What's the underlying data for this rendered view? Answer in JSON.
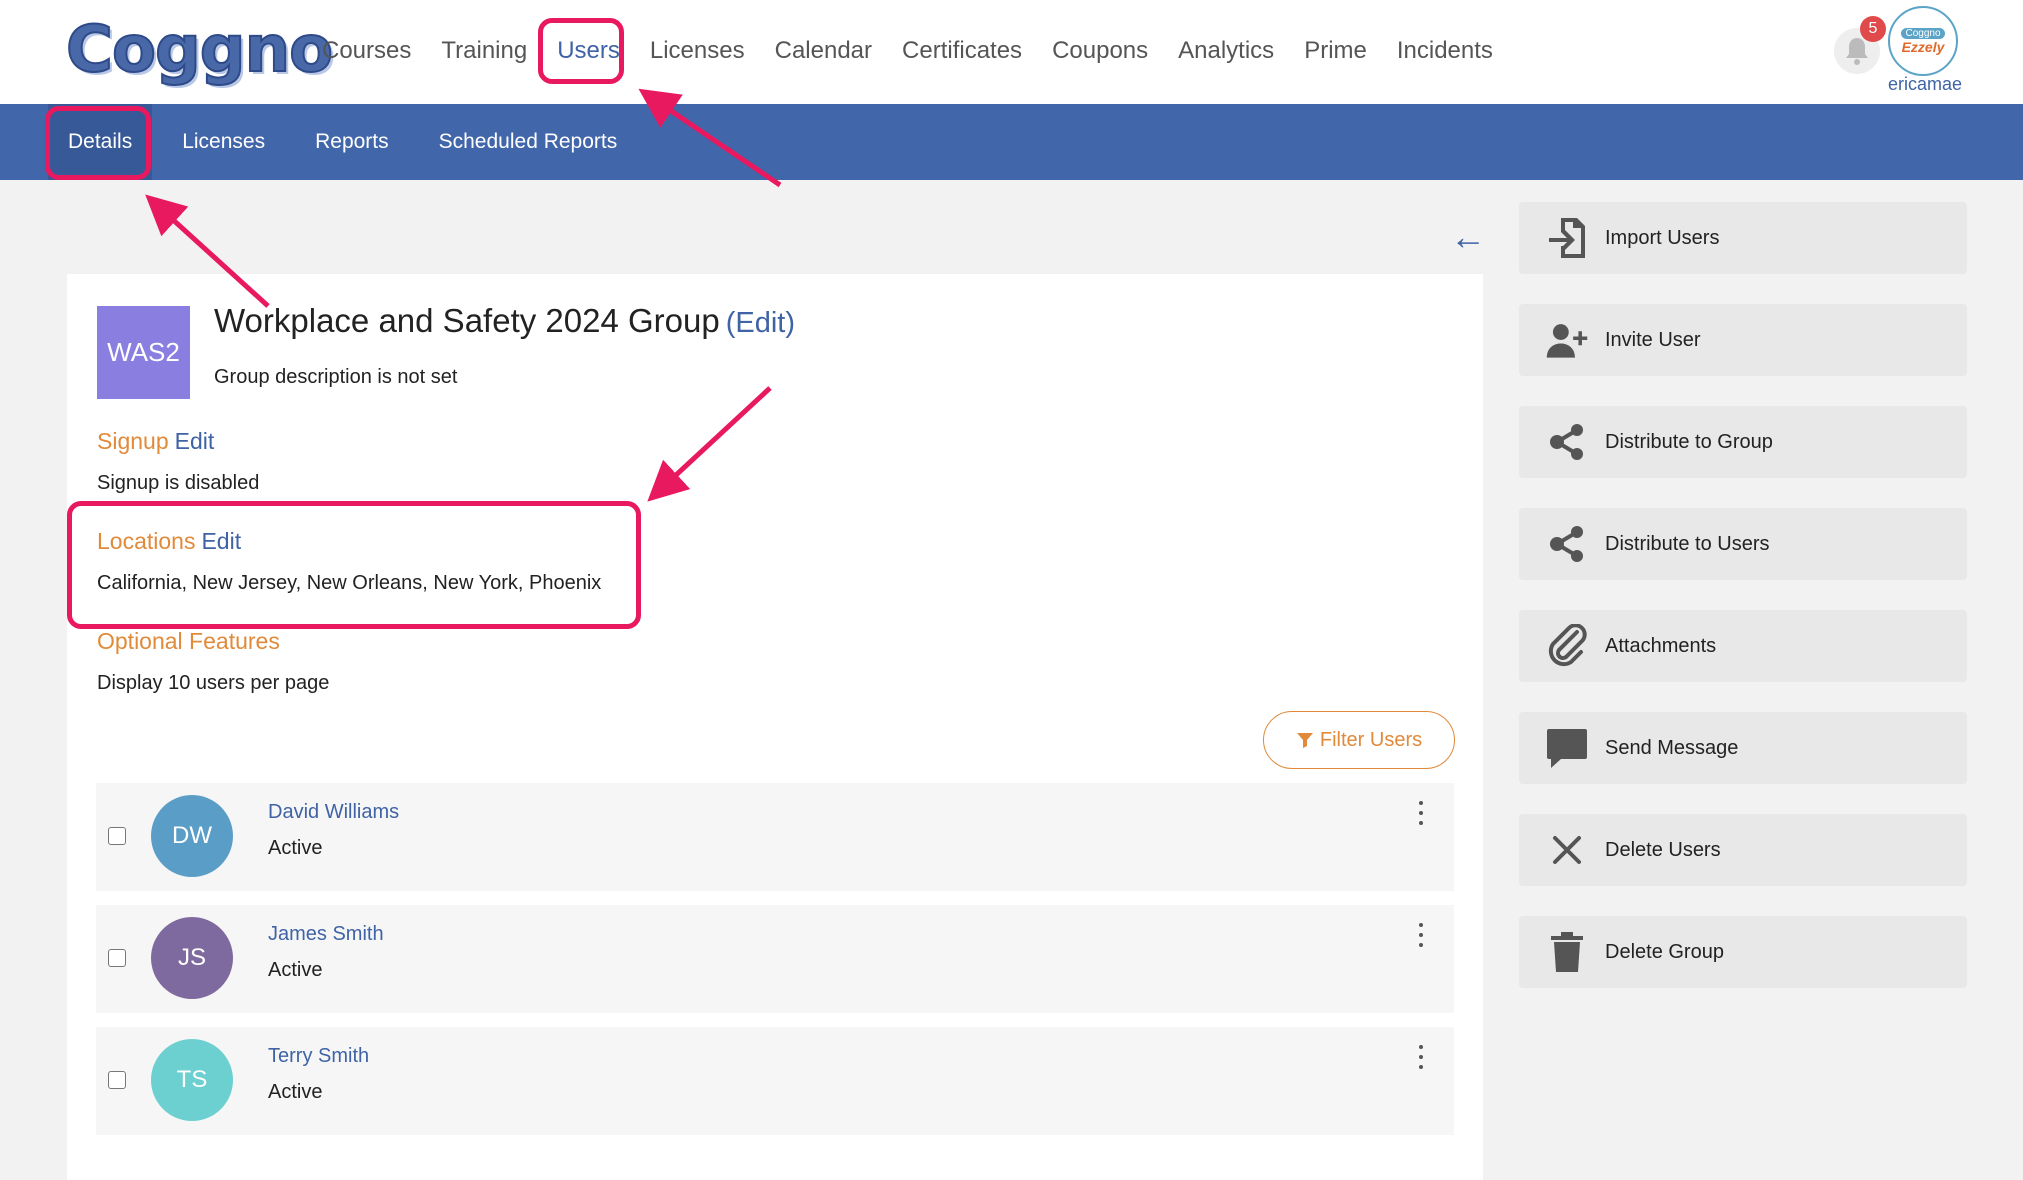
{
  "header": {
    "logo_text": "Coggno",
    "nav": [
      "Courses",
      "Training",
      "Users",
      "Licenses",
      "Calendar",
      "Certificates",
      "Coupons",
      "Analytics",
      "Prime",
      "Incidents"
    ],
    "active_nav": "Users",
    "notification_count": "5",
    "avatar_brand_top": "Coggno",
    "avatar_brand": "Ezzely",
    "username": "ericamae"
  },
  "subnav": {
    "items": [
      "Details",
      "Licenses",
      "Reports",
      "Scheduled Reports"
    ],
    "active": "Details"
  },
  "group": {
    "tile_text": "WAS2",
    "title": "Workplace and Safety 2024 Group",
    "edit_label": "(Edit)",
    "description": "Group description is not set"
  },
  "sections": {
    "signup": {
      "heading": "Signup",
      "edit": "Edit",
      "text": "Signup is disabled"
    },
    "locations": {
      "heading": "Locations",
      "edit": "Edit",
      "text": "California, New Jersey, New Orleans, New York, Phoenix"
    },
    "optional": {
      "heading": "Optional Features",
      "text": "Display 10 users per page"
    }
  },
  "filter_label": "Filter Users",
  "users": [
    {
      "initials": "DW",
      "name": "David Williams",
      "status": "Active",
      "color": "#5a9ec8"
    },
    {
      "initials": "JS",
      "name": "James Smith",
      "status": "Active",
      "color": "#7e6a9e"
    },
    {
      "initials": "TS",
      "name": "Terry Smith",
      "status": "Active",
      "color": "#6ccfd0"
    }
  ],
  "sidebar": [
    {
      "label": "Import Users",
      "icon": "import-icon"
    },
    {
      "label": "Invite User",
      "icon": "add-user-icon"
    },
    {
      "label": "Distribute to Group",
      "icon": "share-icon"
    },
    {
      "label": "Distribute to Users",
      "icon": "share-icon"
    },
    {
      "label": "Attachments",
      "icon": "paperclip-icon"
    },
    {
      "label": "Send Message",
      "icon": "message-icon"
    },
    {
      "label": "Delete Users",
      "icon": "close-icon"
    },
    {
      "label": "Delete Group",
      "icon": "trash-icon"
    }
  ],
  "colors": {
    "brand": "#3f63a5",
    "subnav": "#4266aa",
    "accent": "#e08a3a",
    "annotation": "#e8195f"
  }
}
